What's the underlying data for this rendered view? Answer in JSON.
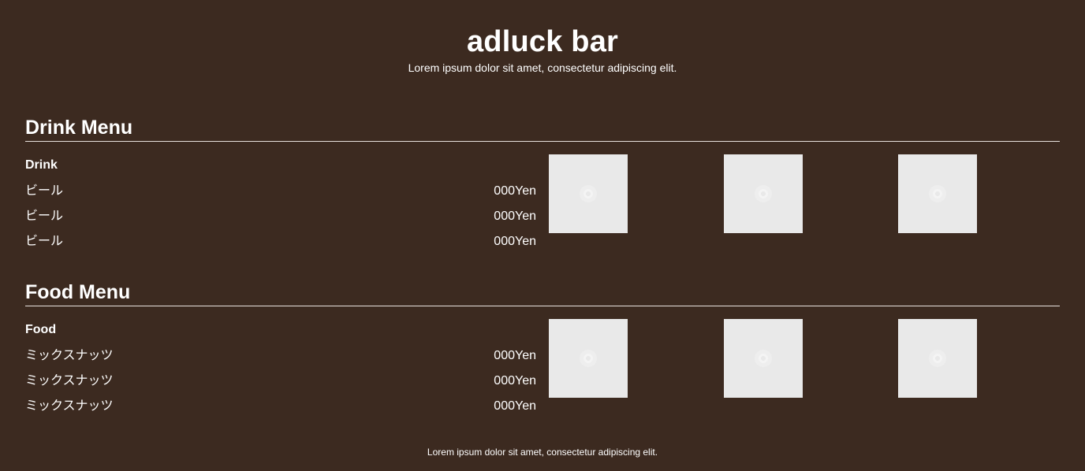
{
  "header": {
    "title": "adluck bar",
    "subtitle": "Lorem ipsum dolor sit amet, consectetur adipiscing elit."
  },
  "drink_menu": {
    "title": "Drink Menu",
    "category": "Drink",
    "items": [
      {
        "name": "ビール",
        "price": "000Yen"
      },
      {
        "name": "ビール",
        "price": "000Yen"
      },
      {
        "name": "ビール",
        "price": "000Yen"
      }
    ]
  },
  "food_menu": {
    "title": "Food Menu",
    "category": "Food",
    "items": [
      {
        "name": "ミックスナッツ",
        "price": "000Yen"
      },
      {
        "name": "ミックスナッツ",
        "price": "000Yen"
      },
      {
        "name": "ミックスナッツ",
        "price": "000Yen"
      }
    ]
  },
  "footer": {
    "text": "Lorem ipsum dolor sit amet, consectetur adipiscing elit."
  }
}
